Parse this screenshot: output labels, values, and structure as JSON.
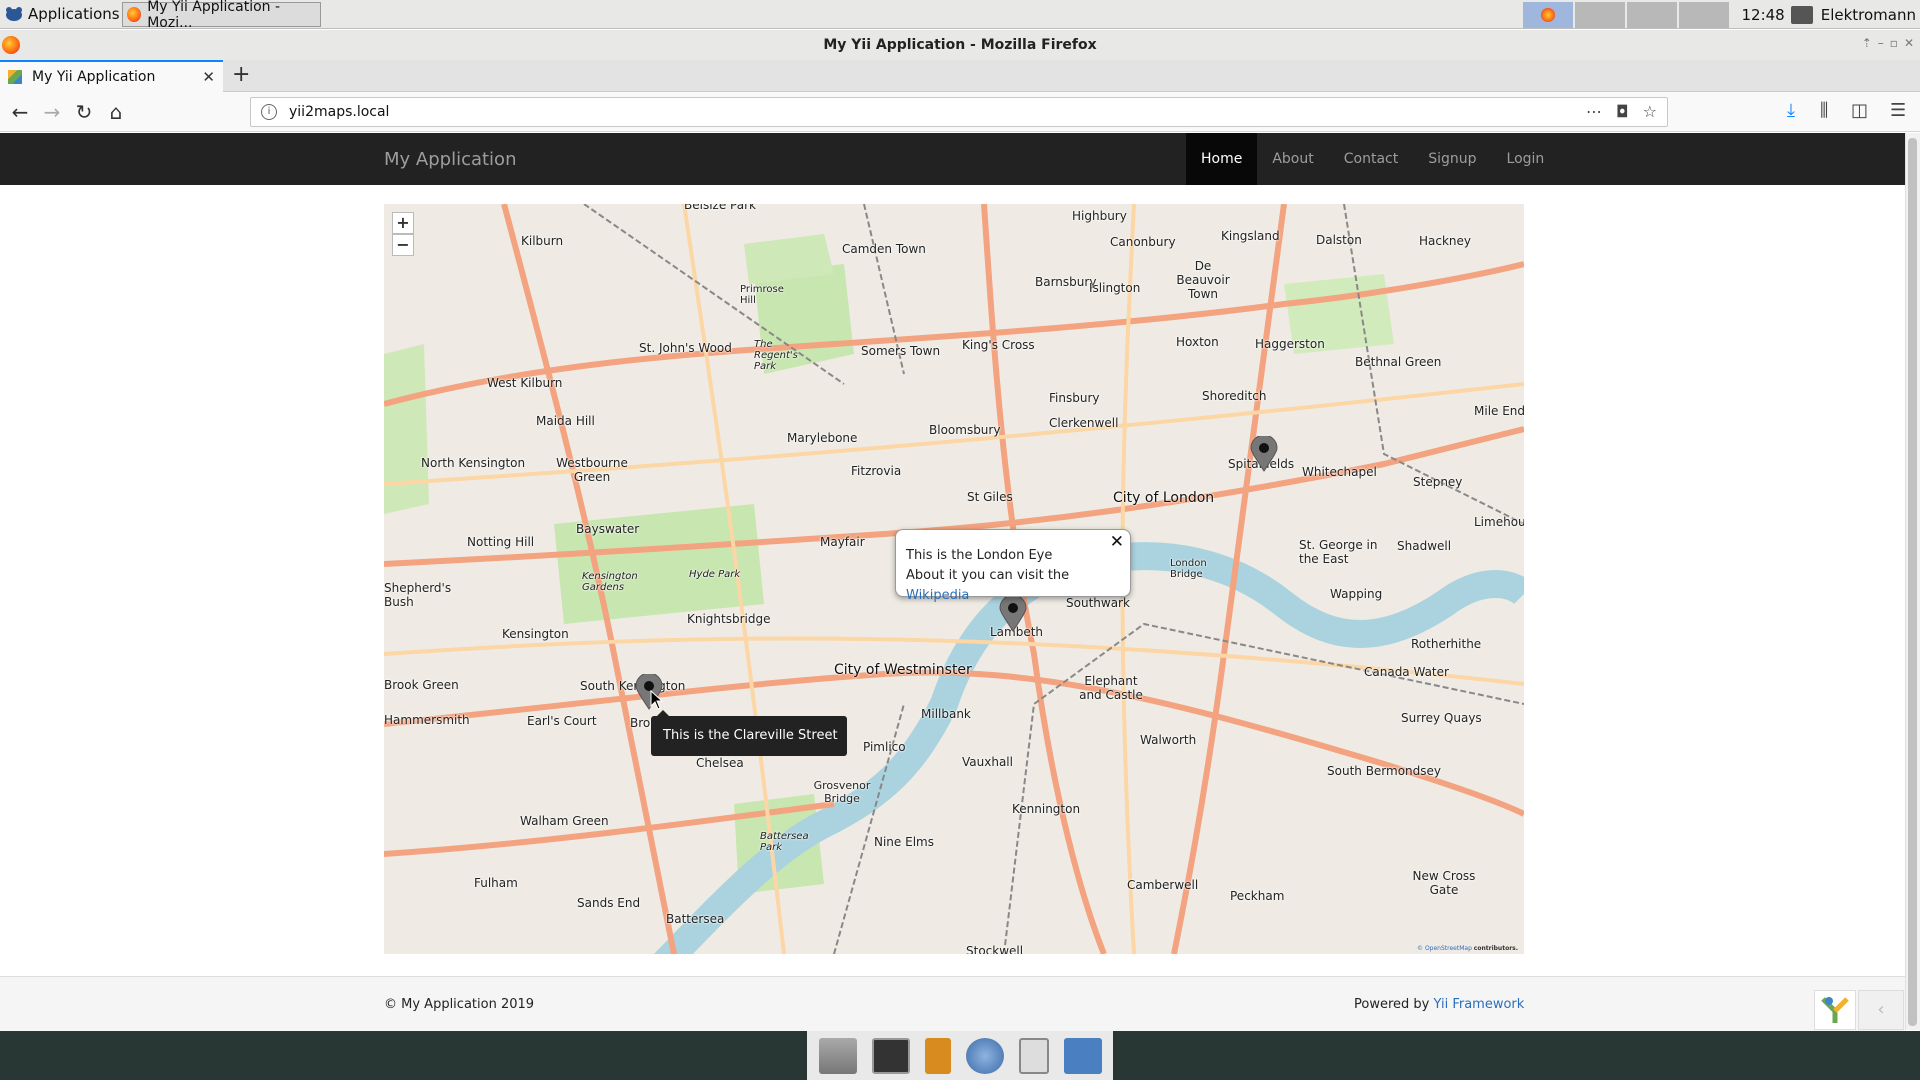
{
  "os": {
    "applications_label": "Applications",
    "task_title": "My Yii Application - Mozi...",
    "clock": "12:48",
    "username": "Elektromann"
  },
  "browser": {
    "window_title": "My Yii Application - Mozilla Firefox",
    "tab_title": "My Yii Application",
    "url": "yii2maps.local"
  },
  "site": {
    "brand": "My Application",
    "menu": [
      {
        "label": "Home",
        "active": true
      },
      {
        "label": "About"
      },
      {
        "label": "Contact"
      },
      {
        "label": "Signup"
      },
      {
        "label": "Login"
      }
    ]
  },
  "map": {
    "zoom_in": "+",
    "zoom_out": "−",
    "place_labels": [
      "Belsize Park",
      "Kilburn",
      "Camden Town",
      "Highbury",
      "Canonbury",
      "Kingsland",
      "Dalston",
      "Hackney",
      "De Beauvoir Town",
      "Primrose Hill",
      "The Regent's Park",
      "St. John's Wood",
      "Somers Town",
      "King's Cross",
      "Barnsbury",
      "Islington",
      "Hoxton",
      "Haggerston",
      "Bethnal Green",
      "West Kilburn",
      "Maida Hill",
      "Marylebone",
      "Bloomsbury",
      "Finsbury",
      "Clerkenwell",
      "Shoreditch",
      "North Kensington",
      "Westbourne Green",
      "Fitzrovia",
      "St Giles",
      "City of London",
      "Spitalfields",
      "Whitechapel",
      "Stepney",
      "Mile End",
      "Notting Hill",
      "Bayswater",
      "Mayfair",
      "Hyde Park",
      "Kensington Gardens",
      "Shadwell",
      "St. George in the East",
      "Limehouse",
      "Shepherd's Bush",
      "Knightsbridge",
      "Lambeth",
      "Southwark",
      "London Bridge",
      "Wapping",
      "Kensington",
      "South Kensington",
      "City of Westminster",
      "Elephant and Castle",
      "Canada Water",
      "Rotherhithe",
      "Brook Green",
      "Earl's Court",
      "Brompton",
      "Millbank",
      "Surrey Quays",
      "Hammersmith",
      "Chelsea",
      "Pimlico",
      "Vauxhall",
      "Walworth",
      "South Bermondsey",
      "Grosvenor Bridge",
      "Kennington",
      "Walham Green",
      "Battersea Park",
      "Nine Elms",
      "Fulham",
      "Sands End",
      "Battersea",
      "Camberwell",
      "Peckham",
      "New Cross Gate",
      "Stockwell"
    ],
    "popup_line1": "This is the London Eye",
    "popup_line2": "About it you can visit the",
    "popup_link": "Wikipedia",
    "tooltip": "This is the Clareville Street",
    "attribution_link": "© OpenStreetMap",
    "attribution_suffix": "contributors."
  },
  "footer": {
    "copyright": "© My Application 2019",
    "powered_prefix": "Powered by",
    "powered_link": "Yii Framework"
  },
  "colors": {
    "navbar": "#222222",
    "accent": "#2a6ebb",
    "map_land": "#f2efe9"
  }
}
